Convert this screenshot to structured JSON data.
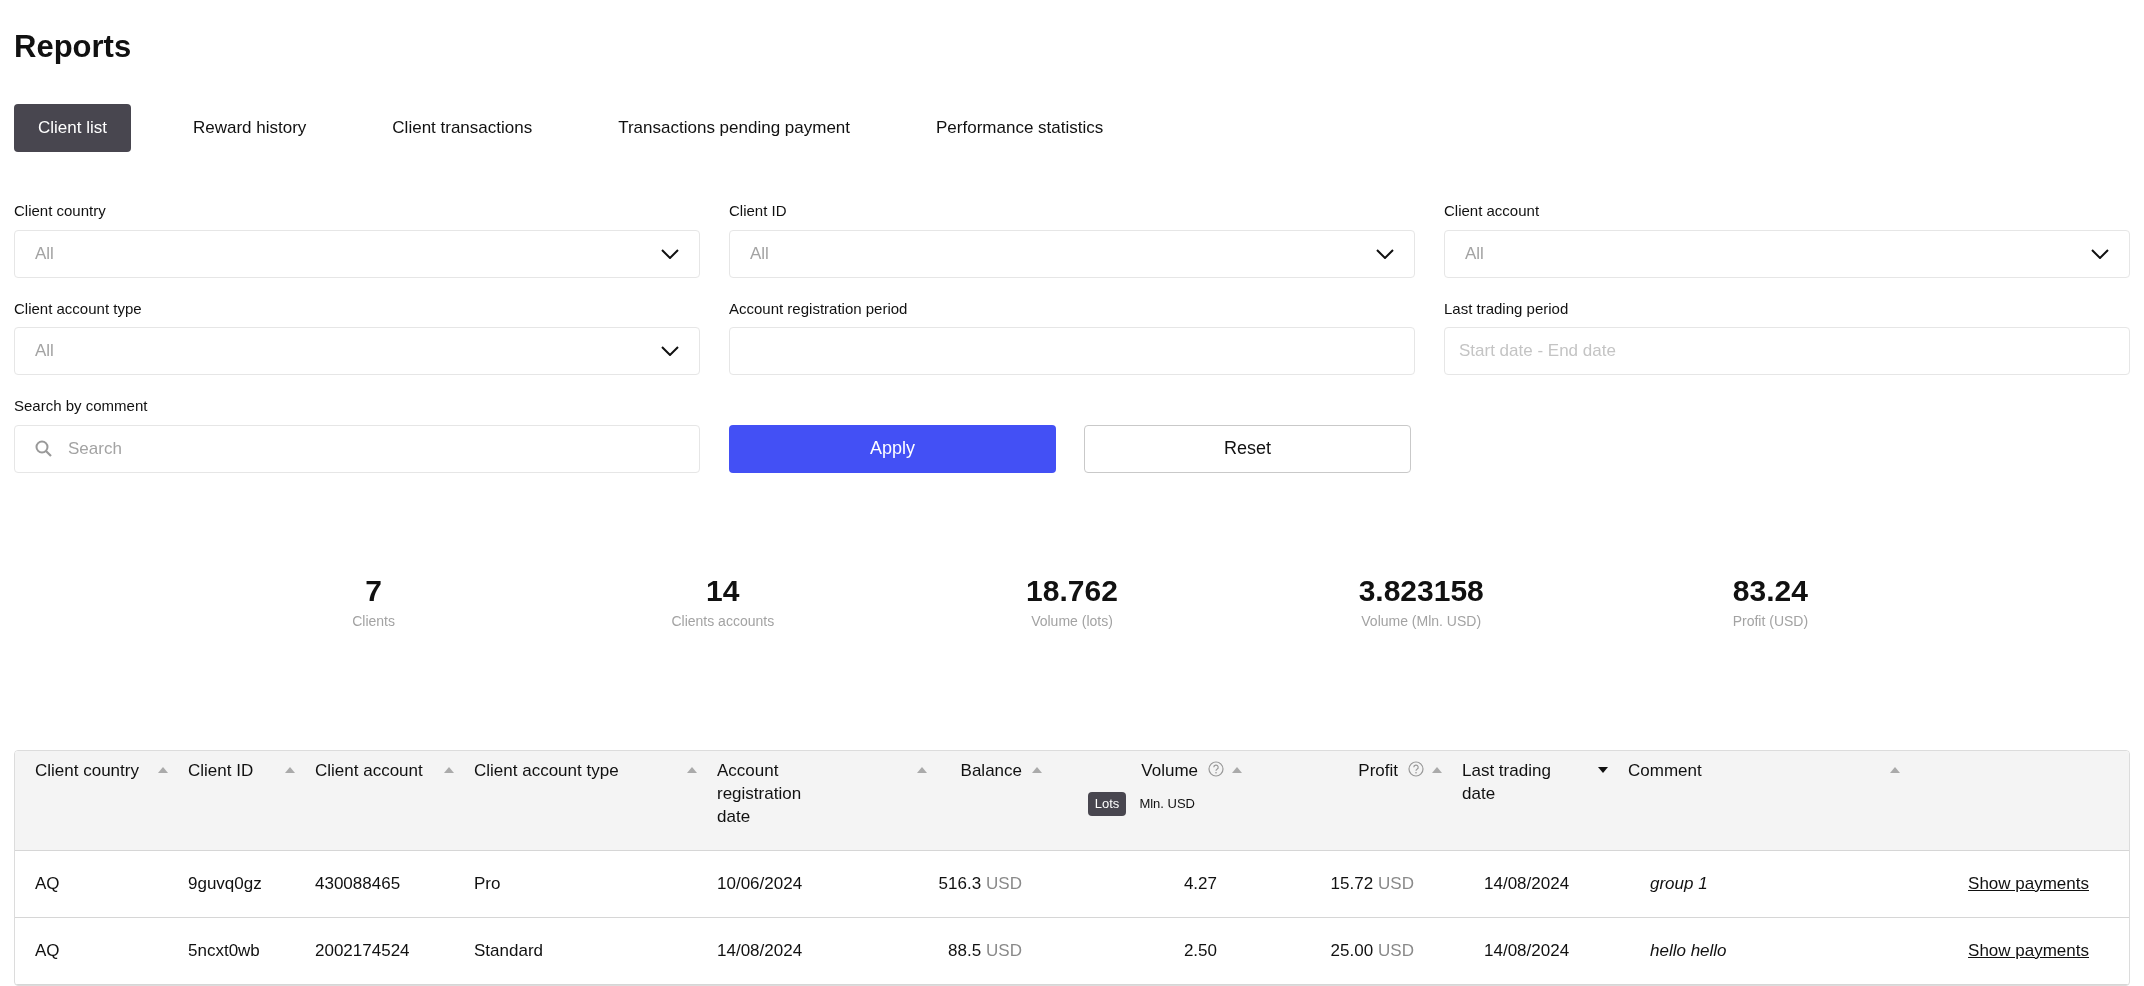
{
  "title": "Reports",
  "tabs": [
    {
      "label": "Client list",
      "selected": true
    },
    {
      "label": "Reward history",
      "selected": false
    },
    {
      "label": "Client transactions",
      "selected": false
    },
    {
      "label": "Transactions pending payment",
      "selected": false
    },
    {
      "label": "Performance statistics",
      "selected": false
    }
  ],
  "filters": [
    {
      "label": "Client country",
      "kind": "select",
      "placeholder": "All"
    },
    {
      "label": "Client ID",
      "kind": "select",
      "placeholder": "All"
    },
    {
      "label": "Client account",
      "kind": "select",
      "placeholder": "All"
    },
    {
      "label": "Client account type",
      "kind": "select",
      "placeholder": "All"
    },
    {
      "label": "Account registration period",
      "kind": "input"
    },
    {
      "label": "Last trading period",
      "kind": "input",
      "placeholder": "Start date - End date"
    },
    {
      "label": "Search by comment",
      "kind": "search",
      "placeholder": "Search"
    }
  ],
  "buttons": [
    {
      "label": "Apply",
      "kind": "primary"
    },
    {
      "label": "Reset",
      "kind": "secondary"
    }
  ],
  "stats": [
    {
      "value": "7",
      "label": "Clients"
    },
    {
      "value": "14",
      "label": "Clients accounts"
    },
    {
      "value": "18.762",
      "label": "Volume (lots)"
    },
    {
      "value": "3.823158",
      "label": "Volume (Mln. USD)"
    },
    {
      "value": "83.24",
      "label": "Profit (USD)"
    }
  ],
  "table": {
    "columns": [
      {
        "label": "Client country",
        "sorted": false
      },
      {
        "label": "Client ID",
        "sorted": false
      },
      {
        "label": "Client account",
        "sorted": false
      },
      {
        "label": "Client account type",
        "sorted": false
      },
      {
        "label": "Account registration date",
        "sorted": false
      },
      {
        "label": "Balance",
        "sorted": false
      },
      {
        "label": "Volume",
        "sorted": false,
        "help": true,
        "units": [
          {
            "label": "Lots",
            "selected": true
          },
          {
            "label": "Mln. USD",
            "selected": false
          }
        ]
      },
      {
        "label": "Profit",
        "sorted": false,
        "help": true
      },
      {
        "label": "Last trading date",
        "sorted": true
      },
      {
        "label": "Comment",
        "sorted": false
      }
    ],
    "rows": [
      {
        "country": "AQ",
        "id": "9guvq0gz",
        "account": "430088465",
        "type": "Pro",
        "registered": "10/06/2024",
        "balance": "516.3",
        "balance_currency": "USD",
        "volume": "4.27",
        "profit": "15.72",
        "profit_currency": "USD",
        "last_trading": "14/08/2024",
        "comment": "group 1",
        "action": "Show payments"
      },
      {
        "country": "AQ",
        "id": "5ncxt0wb",
        "account": "2002174524",
        "type": "Standard",
        "registered": "14/08/2024",
        "balance": "88.5",
        "balance_currency": "USD",
        "volume": "2.50",
        "profit": "25.00",
        "profit_currency": "USD",
        "last_trading": "14/08/2024",
        "comment": "hello hello",
        "action": "Show payments"
      }
    ]
  }
}
